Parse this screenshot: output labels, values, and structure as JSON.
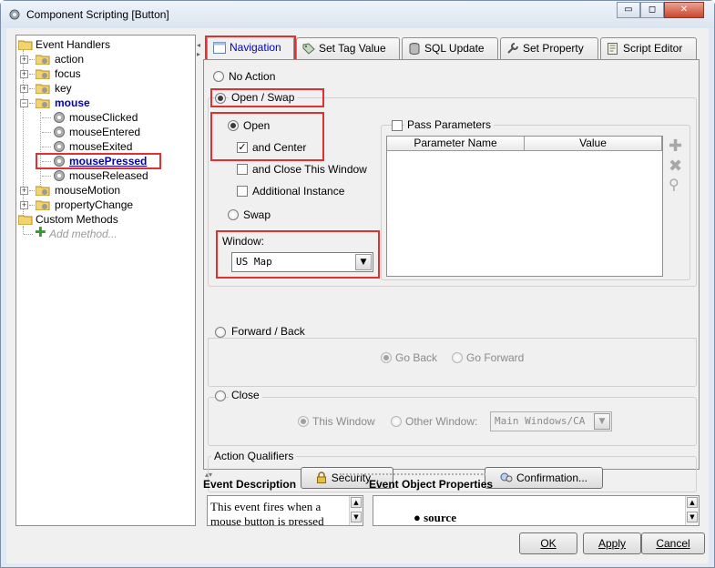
{
  "window": {
    "title": "Component Scripting [Button]",
    "btn_min": "▭",
    "btn_max": "◻",
    "btn_close": "✕"
  },
  "tree": {
    "root": "Event Handlers",
    "items": [
      {
        "label": "action"
      },
      {
        "label": "focus"
      },
      {
        "label": "key"
      },
      {
        "label": "mouse"
      },
      {
        "label": "mouseMotion"
      },
      {
        "label": "propertyChange"
      }
    ],
    "mouse_children": [
      {
        "label": "mouseClicked"
      },
      {
        "label": "mouseEntered"
      },
      {
        "label": "mouseExited"
      },
      {
        "label": "mousePressed"
      },
      {
        "label": "mouseReleased"
      }
    ],
    "custom": "Custom Methods",
    "add_method": "Add method..."
  },
  "tabs": [
    {
      "label": "Navigation"
    },
    {
      "label": "Set Tag Value"
    },
    {
      "label": "SQL Update"
    },
    {
      "label": "Set Property"
    },
    {
      "label": "Script Editor"
    }
  ],
  "nav": {
    "no_action": "No Action",
    "open_swap": "Open / Swap",
    "open": "Open",
    "and_center": "and Center",
    "and_close": "and Close This Window",
    "additional": "Additional Instance",
    "swap": "Swap",
    "window_label": "Window:",
    "window_value": "US Map",
    "pass_params": "Pass Parameters",
    "param_name_col": "Parameter Name",
    "value_col": "Value",
    "forward_back": "Forward / Back",
    "go_back": "Go Back",
    "go_forward": "Go Forward",
    "close": "Close",
    "this_window": "This Window",
    "other_window": "Other Window:",
    "other_window_value": "Main Windows/CA",
    "action_qualifiers": "Action Qualifiers",
    "security_btn": "Security...",
    "confirmation_btn": "Confirmation..."
  },
  "bottom": {
    "event_desc_title": "Event Description",
    "event_desc_text": "This event fires when a mouse button is pressed",
    "event_props_title": "Event Object Properties",
    "source_text": "source"
  },
  "buttons": {
    "ok": "OK",
    "apply": "Apply",
    "cancel": "Cancel"
  },
  "colors": {
    "selected_text": "#0000c0",
    "highlight_box": "#e03030"
  }
}
